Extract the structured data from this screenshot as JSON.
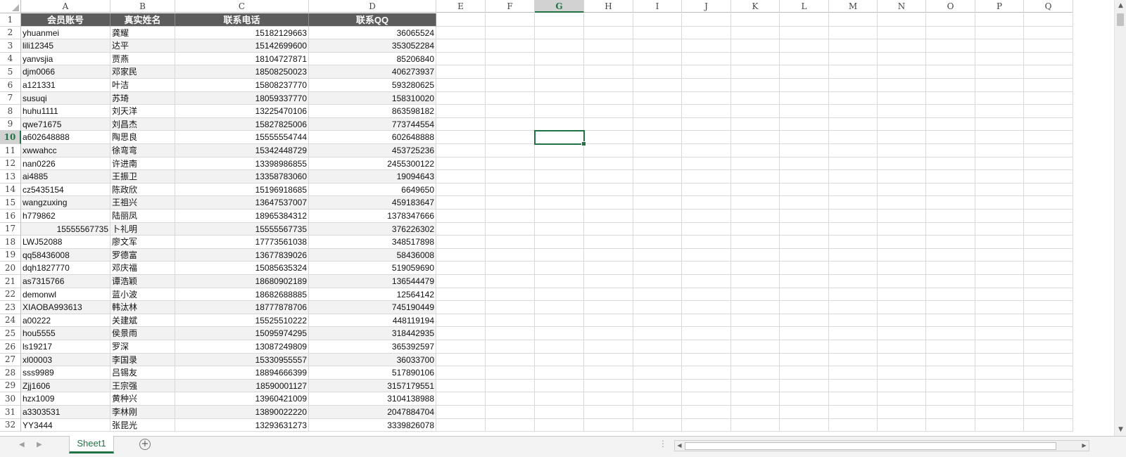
{
  "columns": [
    "A",
    "B",
    "C",
    "D",
    "E",
    "F",
    "G",
    "H",
    "I",
    "J",
    "K",
    "L",
    "M",
    "N",
    "O",
    "P",
    "Q"
  ],
  "selected_column": "G",
  "selected_row": "10",
  "header_row": [
    "会员账号",
    "真实姓名",
    "联系电话",
    "联系QQ"
  ],
  "rows": [
    {
      "num": "1"
    },
    {
      "num": "2",
      "a": "yhuanmei",
      "b": "龚耀",
      "c": "15182129663",
      "d": "36065524"
    },
    {
      "num": "3",
      "a": "lili12345",
      "b": "达平",
      "c": "15142699600",
      "d": "353052284"
    },
    {
      "num": "4",
      "a": "yanvsjia",
      "b": "贾燕",
      "c": "18104727871",
      "d": "85206840"
    },
    {
      "num": "5",
      "a": "djm0066",
      "b": "邓家民",
      "c": "18508250023",
      "d": "406273937"
    },
    {
      "num": "6",
      "a": "a121331",
      "b": "叶洁",
      "c": "15808237770",
      "d": "593280625"
    },
    {
      "num": "7",
      "a": "susuqi",
      "b": "苏琦",
      "c": "18059337770",
      "d": "158310020"
    },
    {
      "num": "8",
      "a": "huhu1111",
      "b": "刘天洋",
      "c": "13225470106",
      "d": "863598182"
    },
    {
      "num": "9",
      "a": "qwe71675",
      "b": "刘昌杰",
      "c": "15827825006",
      "d": "773744554"
    },
    {
      "num": "10",
      "a": "a602648888",
      "b": "陶思良",
      "c": "15555554744",
      "d": "602648888"
    },
    {
      "num": "11",
      "a": "xwwahcc",
      "b": "徐弯弯",
      "c": "15342448729",
      "d": "453725236"
    },
    {
      "num": "12",
      "a": "nan0226",
      "b": "许进南",
      "c": "13398986855",
      "d": "2455300122"
    },
    {
      "num": "13",
      "a": "ai4885",
      "b": "王振卫",
      "c": "13358783060",
      "d": "19094643"
    },
    {
      "num": "14",
      "a": "cz5435154",
      "b": "陈政欣",
      "c": "15196918685",
      "d": "6649650"
    },
    {
      "num": "15",
      "a": "wangzuxing",
      "b": "王祖兴",
      "c": "13647537007",
      "d": "459183647"
    },
    {
      "num": "16",
      "a": "h779862",
      "b": "陆丽凤",
      "c": "18965384312",
      "d": "1378347666"
    },
    {
      "num": "17",
      "a": "15555567735",
      "b": "卜礼明",
      "c": "15555567735",
      "d": "376226302",
      "a_num": true
    },
    {
      "num": "18",
      "a": "LWJ52088",
      "b": "廖文军",
      "c": "17773561038",
      "d": "348517898"
    },
    {
      "num": "19",
      "a": "qq58436008",
      "b": "罗德富",
      "c": "13677839026",
      "d": "58436008"
    },
    {
      "num": "20",
      "a": "dqh1827770",
      "b": "邓庆福",
      "c": "15085635324",
      "d": "519059690"
    },
    {
      "num": "21",
      "a": "as7315766",
      "b": "谭浩颖",
      "c": "18680902189",
      "d": "136544479"
    },
    {
      "num": "22",
      "a": "demonwl",
      "b": "蓝小波",
      "c": "18682688885",
      "d": "12564142"
    },
    {
      "num": "23",
      "a": "XIAOBA993613",
      "b": "韩汰林",
      "c": "18777878706",
      "d": "745190449"
    },
    {
      "num": "24",
      "a": "a00222",
      "b": "关建斌",
      "c": "15525510222",
      "d": "448119194"
    },
    {
      "num": "25",
      "a": "hou5555",
      "b": "侯景雨",
      "c": "15095974295",
      "d": "318442935"
    },
    {
      "num": "26",
      "a": "ls19217",
      "b": "罗深",
      "c": "13087249809",
      "d": "365392597"
    },
    {
      "num": "27",
      "a": "xl00003",
      "b": "李国录",
      "c": "15330955557",
      "d": "36033700"
    },
    {
      "num": "28",
      "a": "sss9989",
      "b": "吕锡友",
      "c": "18894666399",
      "d": "517890106"
    },
    {
      "num": "29",
      "a": "Zjj1606",
      "b": "王宗强",
      "c": "18590001127",
      "d": "3157179551"
    },
    {
      "num": "30",
      "a": "hzx1009",
      "b": "黄种兴",
      "c": "13960421009",
      "d": "3104138988"
    },
    {
      "num": "31",
      "a": "a3303531",
      "b": "李林刚",
      "c": "13890022220",
      "d": "2047884704"
    },
    {
      "num": "32",
      "a": "YY3444",
      "b": "张昆光",
      "c": "13293631273",
      "d": "3339826078"
    }
  ],
  "sheet_tab": "Sheet1",
  "add_sheet_icon": "+",
  "nav_left_icon": "◀",
  "nav_right_icon": "▶",
  "scroll_up_icon": "▲",
  "scroll_down_icon": "▼",
  "scroll_left_icon": "◀",
  "scroll_right_icon": "▶",
  "splitter_icon": "⋮",
  "colors": {
    "accent": "#217346",
    "header_fill": "#5c5c5c",
    "band_fill": "#f2f2f2"
  }
}
